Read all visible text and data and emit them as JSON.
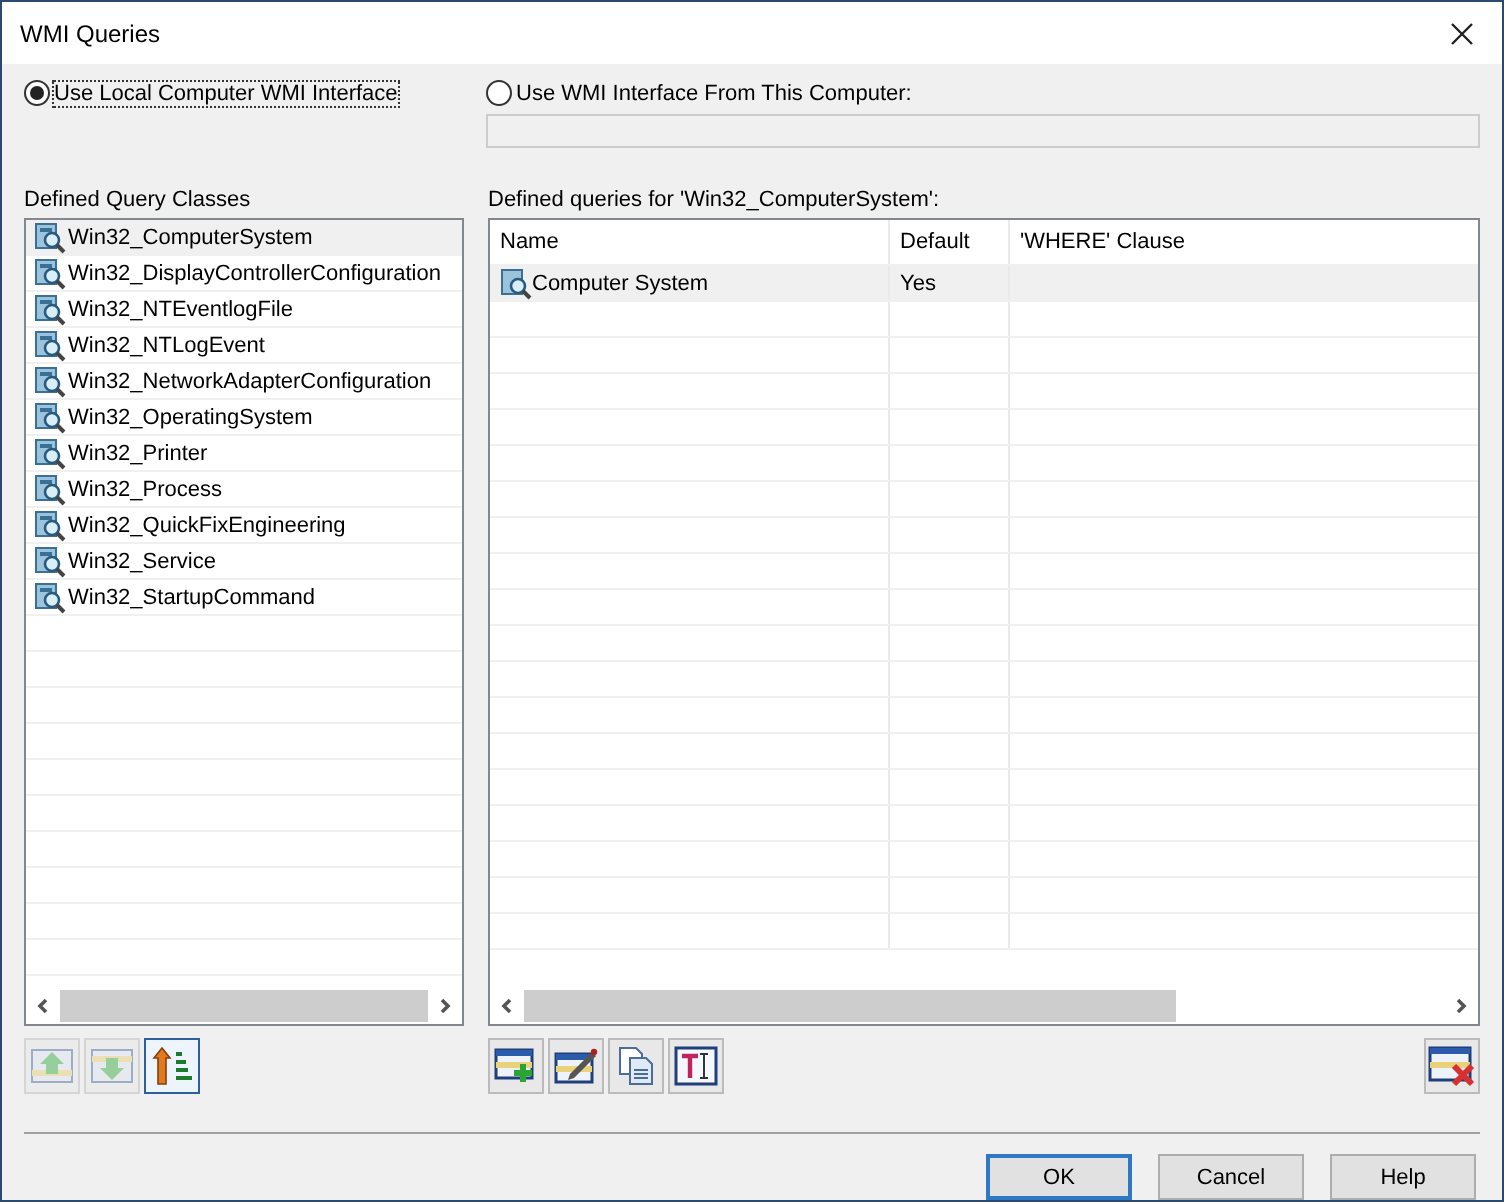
{
  "window": {
    "title": "WMI Queries"
  },
  "interface_options": [
    {
      "label": "Use Local Computer WMI Interface",
      "selected": true
    },
    {
      "label": "Use WMI Interface From This Computer:",
      "selected": false
    }
  ],
  "computer_field": {
    "disabled": true
  },
  "classes": {
    "label": "Defined Query Classes",
    "items": [
      {
        "name": "Win32_ComputerSystem",
        "selected": true
      },
      {
        "name": "Win32_DisplayControllerConfiguration",
        "selected": false
      },
      {
        "name": "Win32_NTEventlogFile",
        "selected": false
      },
      {
        "name": "Win32_NTLogEvent",
        "selected": false
      },
      {
        "name": "Win32_NetworkAdapterConfiguration",
        "selected": false
      },
      {
        "name": "Win32_OperatingSystem",
        "selected": false
      },
      {
        "name": "Win32_Printer",
        "selected": false
      },
      {
        "name": "Win32_Process",
        "selected": false
      },
      {
        "name": "Win32_QuickFixEngineering",
        "selected": false
      },
      {
        "name": "Win32_Service",
        "selected": false
      },
      {
        "name": "Win32_StartupCommand",
        "selected": false
      }
    ]
  },
  "queries": {
    "label": "Defined queries for 'Win32_ComputerSystem':",
    "columns": [
      "Name",
      "Default",
      "'WHERE' Clause"
    ],
    "rows": [
      {
        "name": "Computer System",
        "default": "Yes",
        "selected": true
      }
    ]
  },
  "class_tools": [
    {
      "kind": "up",
      "disabled": true
    },
    {
      "kind": "down",
      "disabled": true
    },
    {
      "kind": "sort",
      "disabled": false
    }
  ],
  "query_tools": [
    {
      "kind": "add"
    },
    {
      "kind": "edit"
    },
    {
      "kind": "copy"
    },
    {
      "kind": "text"
    }
  ],
  "buttons": [
    {
      "label": "OK",
      "default": true
    },
    {
      "label": "Cancel",
      "default": false
    },
    {
      "label": "Help",
      "default": false
    }
  ]
}
